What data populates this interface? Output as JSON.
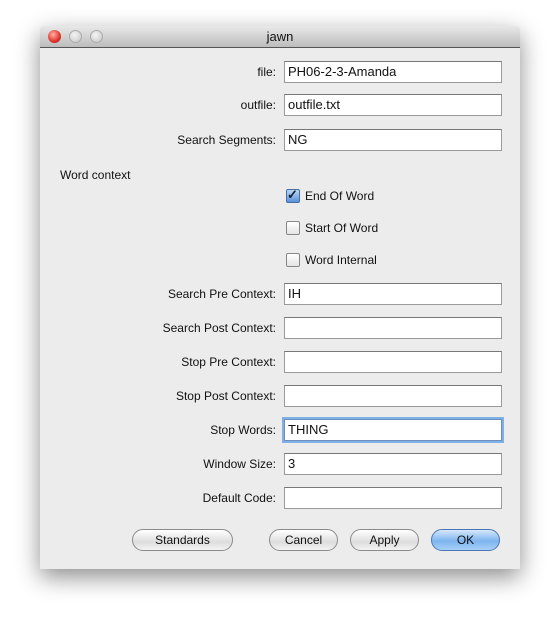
{
  "window": {
    "title": "jawn"
  },
  "fields": [
    {
      "label": "file:",
      "value": "PH06-2-3-Amanda"
    },
    {
      "label": "outfile:",
      "value": "outfile.txt"
    },
    {
      "label": "Search Segments:",
      "value": "NG"
    }
  ],
  "word_context": {
    "heading": "Word context",
    "options": [
      {
        "label": "End Of Word",
        "checked": true
      },
      {
        "label": "Start Of Word",
        "checked": false
      },
      {
        "label": "Word Internal",
        "checked": false
      }
    ]
  },
  "context_fields": [
    {
      "label": "Search Pre Context:",
      "value": "IH"
    },
    {
      "label": "Search Post Context:",
      "value": ""
    },
    {
      "label": "Stop Pre Context:",
      "value": ""
    },
    {
      "label": "Stop Post Context:",
      "value": ""
    },
    {
      "label": "Stop Words:",
      "value": "THING",
      "focused": true
    },
    {
      "label": "Window Size:",
      "value": "3"
    },
    {
      "label": "Default Code:",
      "value": ""
    }
  ],
  "buttons": {
    "standards": "Standards",
    "cancel": "Cancel",
    "apply": "Apply",
    "ok": "OK"
  }
}
